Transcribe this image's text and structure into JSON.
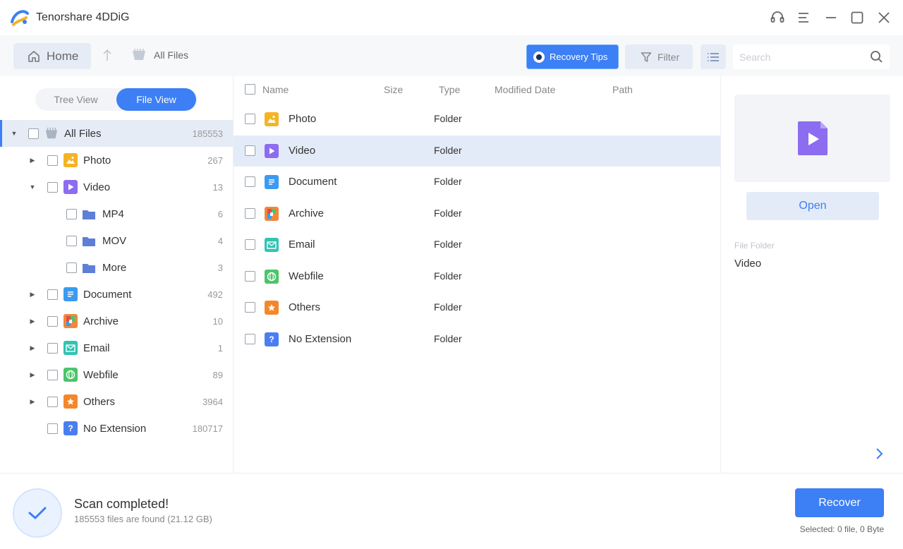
{
  "app": {
    "title": "Tenorshare 4DDiG"
  },
  "toolbar": {
    "home_label": "Home",
    "breadcrumb": "All Files",
    "recovery_tips_label": "Recovery Tips",
    "filter_label": "Filter",
    "search_placeholder": "Search"
  },
  "view_toggle": {
    "tree": "Tree View",
    "file": "File View",
    "active": "File View"
  },
  "tree": {
    "items": [
      {
        "label": "All Files",
        "count": "185553",
        "icon": "all-files-icon",
        "expanded": true,
        "selected": true
      },
      {
        "label": "Photo",
        "count": "267",
        "icon": "photo-icon",
        "expanded": false
      },
      {
        "label": "Video",
        "count": "13",
        "icon": "video-icon",
        "expanded": true
      },
      {
        "label": "MP4",
        "count": "6",
        "icon": "folder-icon"
      },
      {
        "label": "MOV",
        "count": "4",
        "icon": "folder-icon"
      },
      {
        "label": "More",
        "count": "3",
        "icon": "folder-icon"
      },
      {
        "label": "Document",
        "count": "492",
        "icon": "document-icon",
        "expanded": false
      },
      {
        "label": "Archive",
        "count": "10",
        "icon": "archive-icon",
        "expanded": false
      },
      {
        "label": "Email",
        "count": "1",
        "icon": "email-icon",
        "expanded": false
      },
      {
        "label": "Webfile",
        "count": "89",
        "icon": "webfile-icon",
        "expanded": false
      },
      {
        "label": "Others",
        "count": "3964",
        "icon": "others-icon",
        "expanded": false
      },
      {
        "label": "No Extension",
        "count": "180717",
        "icon": "no-extension-icon"
      }
    ]
  },
  "table": {
    "columns": [
      "Name",
      "Size",
      "Type",
      "Modified Date",
      "Path"
    ],
    "rows": [
      {
        "name": "Photo",
        "type": "Folder",
        "icon": "photo-icon"
      },
      {
        "name": "Video",
        "type": "Folder",
        "icon": "video-icon",
        "selected": true
      },
      {
        "name": "Document",
        "type": "Folder",
        "icon": "document-icon"
      },
      {
        "name": "Archive",
        "type": "Folder",
        "icon": "archive-icon"
      },
      {
        "name": "Email",
        "type": "Folder",
        "icon": "email-icon"
      },
      {
        "name": "Webfile",
        "type": "Folder",
        "icon": "webfile-icon"
      },
      {
        "name": "Others",
        "type": "Folder",
        "icon": "others-icon"
      },
      {
        "name": "No Extension",
        "type": "Folder",
        "icon": "no-extension-icon"
      }
    ]
  },
  "preview": {
    "open_label": "Open",
    "file_folder_label": "File Folder",
    "file_folder_value": "Video"
  },
  "status": {
    "title": "Scan completed!",
    "subtitle": "185553 files are found (21.12 GB)",
    "recover_label": "Recover",
    "selected_info": "Selected: 0 file, 0 Byte"
  },
  "colors": {
    "accent": "#3d7ff4",
    "photo": "#f5b324",
    "video": "#8c6cf0",
    "document": "#3a9bf0",
    "archive": "#f0883a",
    "email": "#2fc4b2",
    "webfile": "#4cc46a",
    "others": "#f4872c",
    "no_extension": "#4a7ef0",
    "folder": "#5e7fd6"
  }
}
